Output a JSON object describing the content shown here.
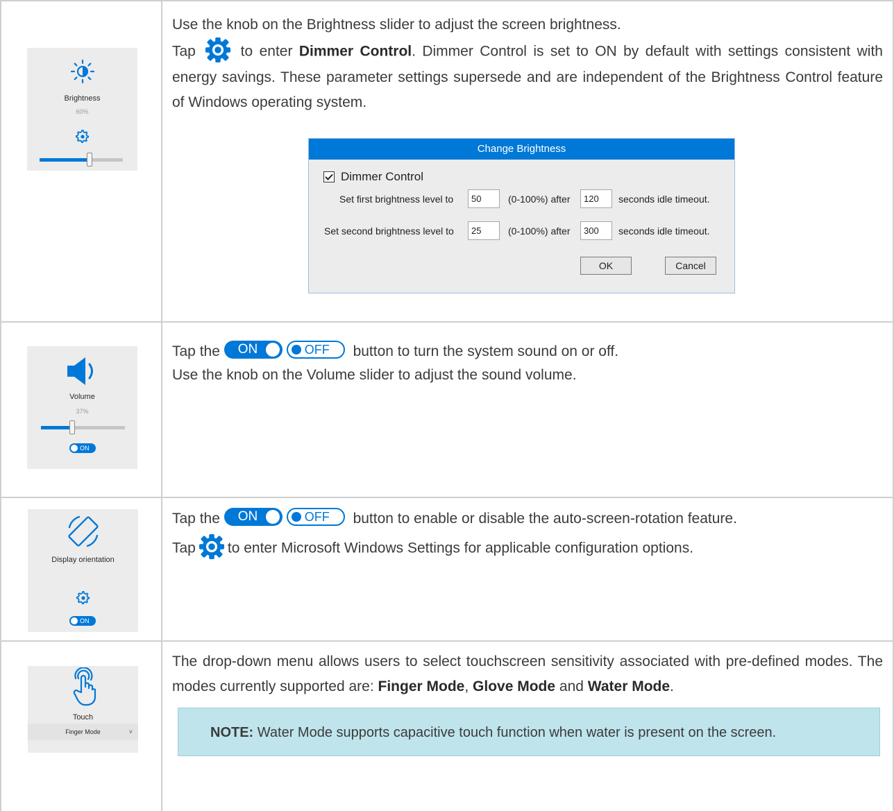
{
  "brightness": {
    "tile_label": "Brightness",
    "tile_value": "60%",
    "slider_fraction": 0.6,
    "line1": "Use the knob on the Brightness slider to adjust the screen brightness.",
    "line2_pre": "Tap",
    "line2_post": "to enter",
    "dimmer_bold": "Dimmer Control",
    "line2_rest": ". Dimmer Control is set to ON by default with settings consistent with energy savings. These parameter settings supersede and are independent of the Brightness Control feature of Windows operating system.",
    "dialog": {
      "title": "Change Brightness",
      "checkbox_label": "Dimmer Control",
      "checked": true,
      "first_label": "Set first brightness level to",
      "first_level": "50",
      "first_range": "(0-100%) after",
      "first_seconds": "120",
      "first_suffix": "seconds idle timeout.",
      "second_label": "Set second brightness level to",
      "second_level": "25",
      "second_range": "(0-100%) after",
      "second_seconds": "300",
      "second_suffix": "seconds idle timeout.",
      "ok": "OK",
      "cancel": "Cancel"
    }
  },
  "volume": {
    "tile_label": "Volume",
    "tile_value": "37%",
    "slider_fraction": 0.37,
    "tile_toggle": "ON",
    "pre": "Tap the",
    "on": "ON",
    "off": "OFF",
    "post": "button to turn the system sound on or off.",
    "line2": "Use the knob on the Volume slider to adjust the sound volume."
  },
  "orientation": {
    "tile_label": "Display orientation",
    "tile_toggle": "ON",
    "pre": "Tap the",
    "on": "ON",
    "off": "OFF",
    "post": "button to enable or disable the auto-screen-rotation feature.",
    "line2_pre": "Tap",
    "line2_post": "to enter Microsoft Windows Settings for applicable configuration options."
  },
  "touch": {
    "tile_label": "Touch",
    "dropdown_value": "Finger Mode",
    "text_pre": "The drop-down menu allows users to select touchscreen sensitivity associated with pre-defined modes. The modes currently supported are:",
    "finger": "Finger Mode",
    "sep1": ",",
    "glove": "Glove Mode",
    "and": "and",
    "water": "Water Mode",
    "end": ".",
    "note_bold": "NOTE:",
    "note_text": "Water Mode supports capacitive touch function when water is present on the screen."
  },
  "colors": {
    "accent": "#0078d7",
    "note_bg": "#bfe4ec",
    "tile_bg": "#ececec"
  },
  "icons": [
    "brightness-icon",
    "gear-icon",
    "speaker-icon",
    "rotate-icon",
    "touch-icon"
  ]
}
